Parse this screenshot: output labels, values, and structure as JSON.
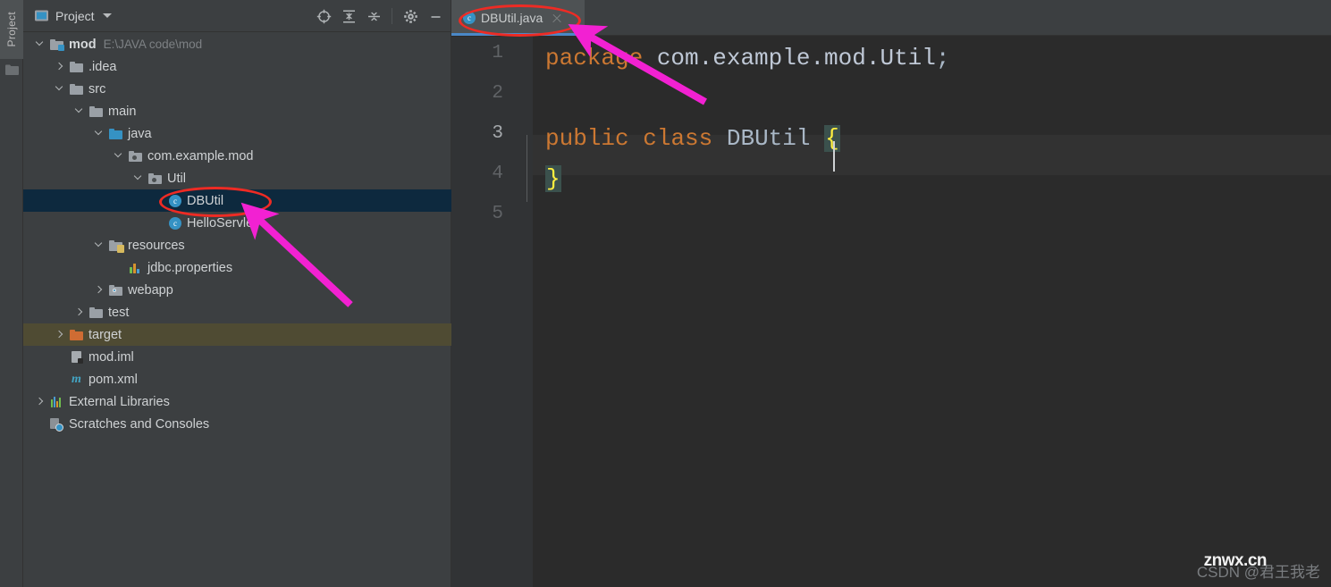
{
  "toolstrip": {
    "tab_label": "Project",
    "folder_icon": "folder-icon"
  },
  "panel": {
    "title": "Project",
    "title_icon": "project-view-icon",
    "dropdown_icon": "chevron-down-icon",
    "actions": [
      {
        "name": "select-opened-file-icon",
        "title": "Select Opened File"
      },
      {
        "name": "expand-all-icon",
        "title": "Expand All"
      },
      {
        "name": "collapse-all-icon",
        "title": "Collapse All"
      },
      {
        "name": "gear-icon",
        "title": "Settings"
      },
      {
        "name": "minimize-icon",
        "title": "Hide"
      }
    ]
  },
  "tree": {
    "rows": [
      {
        "label": "mod",
        "sublabel": "E:\\JAVA code\\mod",
        "indent": 0,
        "arrow": "down",
        "icon": "module-folder-icon",
        "bold": true,
        "state": ""
      },
      {
        "label": ".idea",
        "sublabel": "",
        "indent": 1,
        "arrow": "right",
        "icon": "folder-icon",
        "bold": false,
        "state": ""
      },
      {
        "label": "src",
        "sublabel": "",
        "indent": 1,
        "arrow": "down",
        "icon": "folder-icon",
        "bold": false,
        "state": ""
      },
      {
        "label": "main",
        "sublabel": "",
        "indent": 2,
        "arrow": "down",
        "icon": "folder-icon",
        "bold": false,
        "state": ""
      },
      {
        "label": "java",
        "sublabel": "",
        "indent": 3,
        "arrow": "down",
        "icon": "source-folder-icon",
        "bold": false,
        "state": ""
      },
      {
        "label": "com.example.mod",
        "sublabel": "",
        "indent": 4,
        "arrow": "down",
        "icon": "package-icon",
        "bold": false,
        "state": ""
      },
      {
        "label": "Util",
        "sublabel": "",
        "indent": 5,
        "arrow": "down",
        "icon": "package-icon",
        "bold": false,
        "state": ""
      },
      {
        "label": "DBUtil",
        "sublabel": "",
        "indent": 6,
        "arrow": "none",
        "icon": "java-class-icon",
        "bold": false,
        "state": "selected"
      },
      {
        "label": "HelloServlet",
        "sublabel": "",
        "indent": 6,
        "arrow": "none",
        "icon": "java-class-icon",
        "bold": false,
        "state": ""
      },
      {
        "label": "resources",
        "sublabel": "",
        "indent": 3,
        "arrow": "down",
        "icon": "resources-folder-icon",
        "bold": false,
        "state": ""
      },
      {
        "label": "jdbc.properties",
        "sublabel": "",
        "indent": 4,
        "arrow": "none",
        "icon": "properties-file-icon",
        "bold": false,
        "state": ""
      },
      {
        "label": "webapp",
        "sublabel": "",
        "indent": 3,
        "arrow": "right",
        "icon": "web-folder-icon",
        "bold": false,
        "state": ""
      },
      {
        "label": "test",
        "sublabel": "",
        "indent": 2,
        "arrow": "right",
        "icon": "folder-icon",
        "bold": false,
        "state": ""
      },
      {
        "label": "target",
        "sublabel": "",
        "indent": 1,
        "arrow": "right",
        "icon": "excluded-folder-icon",
        "bold": false,
        "state": "marked"
      },
      {
        "label": "mod.iml",
        "sublabel": "",
        "indent": 1,
        "arrow": "none",
        "icon": "iml-file-icon",
        "bold": false,
        "state": ""
      },
      {
        "label": "pom.xml",
        "sublabel": "",
        "indent": 1,
        "arrow": "none",
        "icon": "maven-file-icon",
        "bold": false,
        "state": ""
      },
      {
        "label": "External Libraries",
        "sublabel": "",
        "indent": 0,
        "arrow": "right",
        "icon": "libraries-icon",
        "bold": false,
        "state": ""
      },
      {
        "label": "Scratches and Consoles",
        "sublabel": "",
        "indent": 0,
        "arrow": "none",
        "icon": "scratches-icon",
        "bold": false,
        "state": ""
      }
    ]
  },
  "editor": {
    "tab": {
      "label": "DBUtil.java",
      "file_icon": "java-class-icon",
      "close_icon": "close-icon"
    },
    "line_numbers": [
      "1",
      "2",
      "3",
      "4",
      "5"
    ],
    "current_line": "3",
    "code_lines": [
      {
        "num": "1",
        "tokens": [
          {
            "t": "package",
            "c": "kw"
          },
          {
            "t": " ",
            "c": "punc"
          },
          {
            "t": "com.example.mod.Util",
            "c": "pkg"
          },
          {
            "t": ";",
            "c": "punc"
          }
        ]
      },
      {
        "num": "2",
        "tokens": []
      },
      {
        "num": "3",
        "tokens": [
          {
            "t": "public",
            "c": "kw"
          },
          {
            "t": " ",
            "c": "punc"
          },
          {
            "t": "class",
            "c": "kw"
          },
          {
            "t": " ",
            "c": "punc"
          },
          {
            "t": "DBUtil",
            "c": "cls"
          },
          {
            "t": " ",
            "c": "punc"
          },
          {
            "t": "{",
            "c": "brace-hl"
          }
        ]
      },
      {
        "num": "4",
        "tokens": [
          {
            "t": "}",
            "c": "brace-hl"
          }
        ]
      },
      {
        "num": "5",
        "tokens": []
      }
    ]
  },
  "annotations": {
    "ellipse_tab_label": "DBUtil.java",
    "ellipse_tree_label": "DBUtil",
    "arrow_color": "#f221d2",
    "ellipse_color": "#ee2b24"
  },
  "watermark": {
    "csdn": "CSDN @君王我老",
    "site": "znwx.cn"
  }
}
